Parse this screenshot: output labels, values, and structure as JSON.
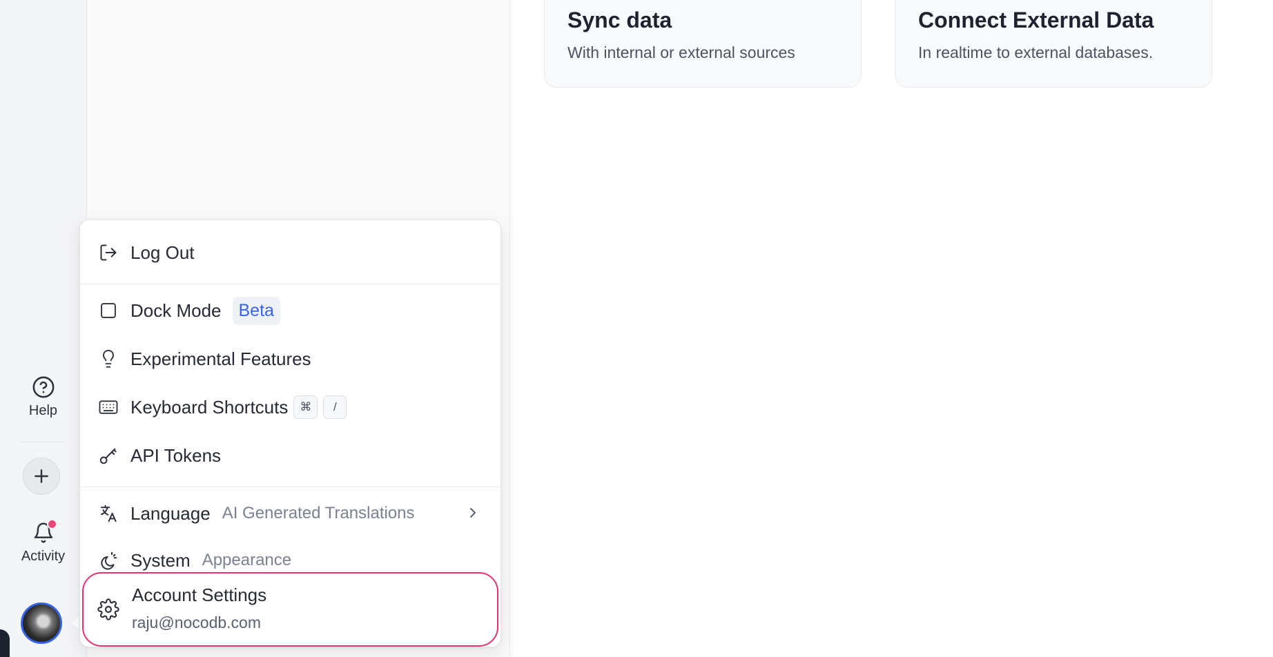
{
  "rail": {
    "help_label": "Help",
    "activity_label": "Activity",
    "icons": [
      "help-circle-icon",
      "plus-icon",
      "bell-icon"
    ]
  },
  "cards": {
    "sync": {
      "title": "Sync data",
      "subtitle": "With internal or external sources"
    },
    "connect": {
      "title": "Connect External Data",
      "subtitle": "In realtime to external databases."
    }
  },
  "menu": {
    "logout": "Log Out",
    "dock_mode": "Dock Mode",
    "beta_badge": "Beta",
    "experimental": "Experimental Features",
    "shortcuts": "Keyboard Shortcuts",
    "shortcut_keys": [
      "⌘",
      "/"
    ],
    "api_tokens": "API Tokens",
    "language": "Language",
    "language_sub": "AI Generated Translations",
    "system": "System",
    "system_sub": "Appearance",
    "account_settings": "Account Settings",
    "account_email": "raju@nocodb.com"
  },
  "colors": {
    "accent": "#3a63e6",
    "highlight_border": "#e5336f",
    "notification_dot": "#f0457a"
  }
}
